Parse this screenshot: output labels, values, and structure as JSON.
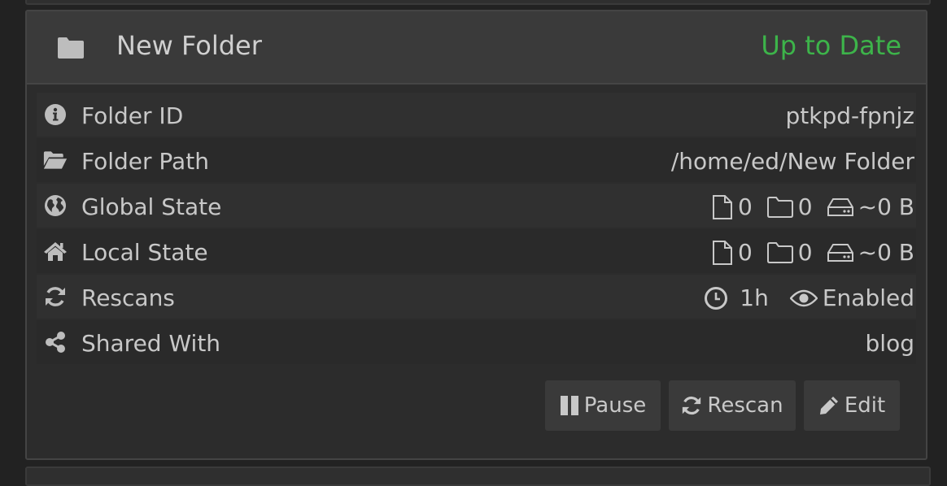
{
  "folder": {
    "title": "New Folder",
    "status": "Up to Date",
    "status_color": "#3db44a",
    "header_icon": "folder-icon"
  },
  "rows": [
    {
      "label": "Folder ID",
      "icon": "info-circle-icon",
      "value": "ptkpd-fpnjz"
    },
    {
      "label": "Folder Path",
      "icon": "folder-open-icon",
      "value": "/home/ed/New Folder"
    },
    {
      "label": "Global State",
      "icon": "globe-icon",
      "files": "0",
      "dirs": "0",
      "size": "~0 B"
    },
    {
      "label": "Local State",
      "icon": "home-icon",
      "files": "0",
      "dirs": "0",
      "size": "~0 B"
    },
    {
      "label": "Rescans",
      "icon": "refresh-icon",
      "interval": "1h",
      "watcher": "Enabled"
    },
    {
      "label": "Shared With",
      "icon": "share-icon",
      "value": "blog"
    }
  ],
  "buttons": {
    "pause": "Pause",
    "rescan": "Rescan",
    "edit": "Edit"
  }
}
